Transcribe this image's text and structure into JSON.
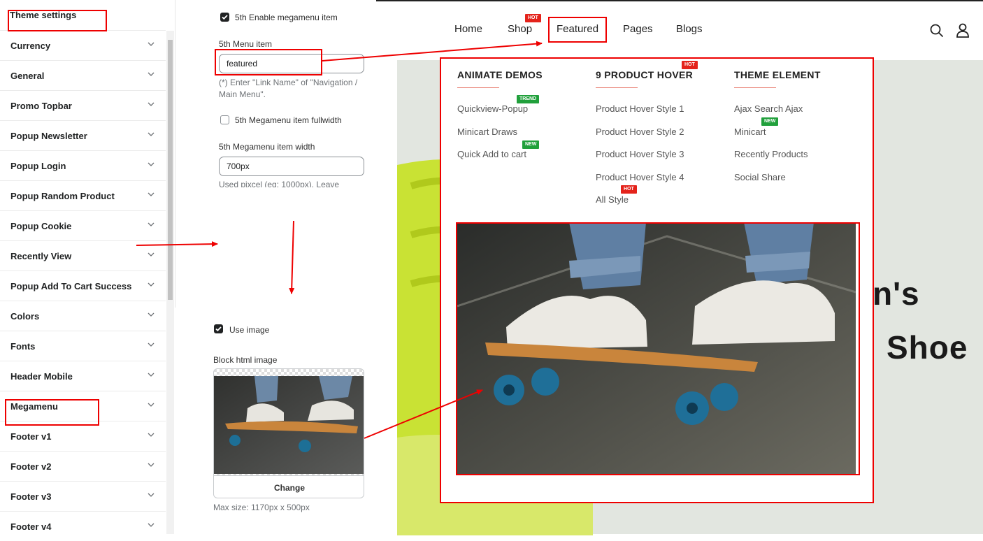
{
  "sidebar": {
    "title": "Theme settings",
    "items": [
      {
        "label": "Currency"
      },
      {
        "label": "General"
      },
      {
        "label": "Promo Topbar"
      },
      {
        "label": "Popup Newsletter"
      },
      {
        "label": "Popup Login"
      },
      {
        "label": "Popup Random Product"
      },
      {
        "label": "Popup Cookie"
      },
      {
        "label": "Recently View"
      },
      {
        "label": "Popup Add To Cart Success"
      },
      {
        "label": "Colors"
      },
      {
        "label": "Fonts"
      },
      {
        "label": "Header Mobile"
      },
      {
        "label": "Megamenu"
      },
      {
        "label": "Footer v1"
      },
      {
        "label": "Footer v2"
      },
      {
        "label": "Footer v3"
      },
      {
        "label": "Footer v4"
      }
    ]
  },
  "settings": {
    "enable_label": "5th Enable megamenu item",
    "enable_checked": true,
    "menu_item_label": "5th Menu item",
    "menu_item_value": "featured",
    "menu_item_hint": "(*) Enter \"Link Name\" of \"Navigation / Main Menu\".",
    "fullwidth_label": "5th Megamenu item fullwidth",
    "fullwidth_checked": false,
    "width_label": "5th Megamenu item width",
    "width_value": "700px",
    "width_hint": "Used pixcel (eg: 1000px). Leave",
    "use_image_label": "Use image",
    "use_image_checked": true,
    "block_image_label": "Block html image",
    "change_label": "Change",
    "max_size": "Max size: 1170px x 500px"
  },
  "store": {
    "nav": [
      {
        "label": "Home"
      },
      {
        "label": "Shop",
        "badge": "HOT"
      },
      {
        "label": "Featured"
      },
      {
        "label": "Pages"
      },
      {
        "label": "Blogs"
      }
    ],
    "icons": [
      "search-icon",
      "user-icon"
    ],
    "hero_line1": "n's",
    "hero_line2": "Shoe",
    "mega": {
      "columns": [
        {
          "heading": "ANIMATE DEMOS",
          "links": [
            {
              "label": "Quickview-Popup",
              "badge": "TREND"
            },
            {
              "label": "Minicart Draws"
            },
            {
              "label": "Quick Add to cart",
              "badge": "NEW"
            }
          ]
        },
        {
          "heading": "9 PRODUCT HOVER",
          "badge": "HOT",
          "links": [
            {
              "label": "Product Hover Style 1"
            },
            {
              "label": "Product Hover Style 2"
            },
            {
              "label": "Product Hover Style 3"
            },
            {
              "label": "Product Hover Style 4"
            },
            {
              "label": "All Style",
              "badge": "HOT"
            }
          ]
        },
        {
          "heading": "THEME ELEMENT",
          "links": [
            {
              "label": "Ajax Search Ajax"
            },
            {
              "label": "Minicart",
              "badge": "NEW"
            },
            {
              "label": "Recently Products"
            },
            {
              "label": "Social Share"
            }
          ]
        }
      ]
    }
  },
  "colors": {
    "annotation": "#e00000",
    "badge_hot": "#e4231b",
    "badge_new": "#21a03c",
    "hero_bg": "#e2e6e0"
  }
}
